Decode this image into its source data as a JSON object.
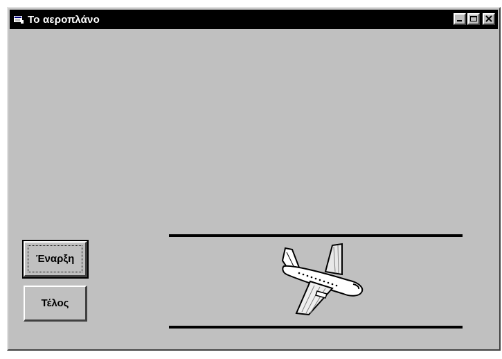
{
  "window": {
    "title": "Το αεροπλάνο",
    "title_bar_color": "#000000",
    "background_color": "#c0c0c0"
  },
  "title_buttons": {
    "minimize": "minimize-icon",
    "maximize": "maximize-icon",
    "close": "close-icon"
  },
  "buttons": {
    "start_label": "Έναρξη",
    "end_label": "Τέλος"
  },
  "sprite": {
    "icon": "airplane-icon"
  }
}
